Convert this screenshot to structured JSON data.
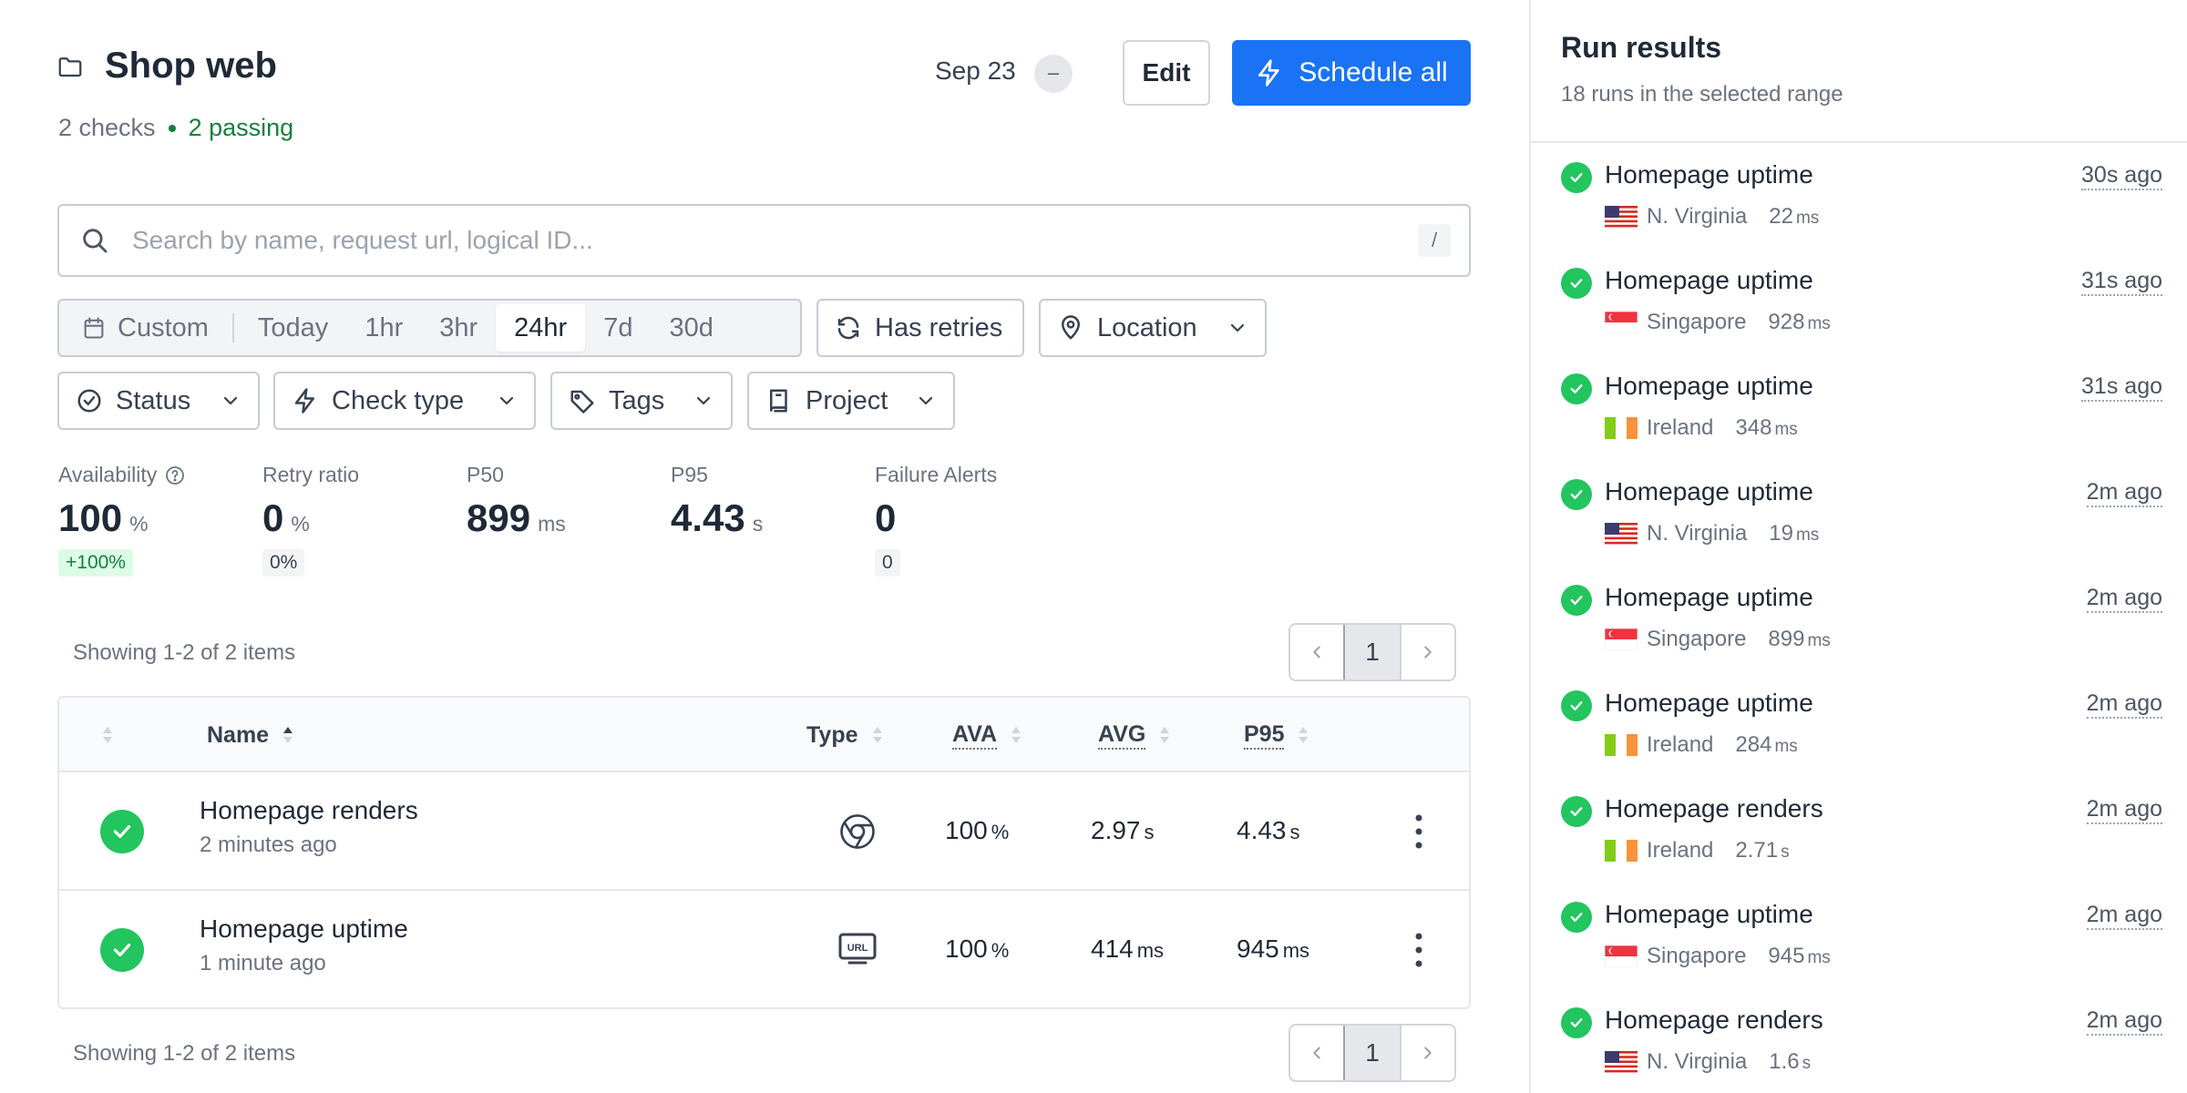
{
  "header": {
    "title": "Shop web",
    "checks_count": "2 checks",
    "passing": "2 passing",
    "date": "Sep 23",
    "date_clear": "–",
    "edit_label": "Edit",
    "schedule_label": "Schedule all"
  },
  "search": {
    "placeholder": "Search by name, request url, logical ID...",
    "shortcut": "/"
  },
  "time_ranges": {
    "custom": "Custom",
    "options": [
      "Today",
      "1hr",
      "3hr",
      "24hr",
      "7d",
      "30d"
    ],
    "selected": "24hr"
  },
  "filters": {
    "retries": "Has retries",
    "location": "Location",
    "status": "Status",
    "check_type": "Check type",
    "tags": "Tags",
    "project": "Project"
  },
  "stats": {
    "availability": {
      "label": "Availability",
      "value": "100",
      "unit": "%",
      "delta": "+100%"
    },
    "retry_ratio": {
      "label": "Retry ratio",
      "value": "0",
      "unit": "%",
      "delta": "0%"
    },
    "p50": {
      "label": "P50",
      "value": "899",
      "unit": "ms"
    },
    "p95": {
      "label": "P95",
      "value": "4.43",
      "unit": "s"
    },
    "failure_alerts": {
      "label": "Failure Alerts",
      "value": "0",
      "delta": "0"
    }
  },
  "pagination": {
    "showing": "Showing 1-2 of 2 items",
    "page": "1"
  },
  "table": {
    "columns": {
      "name": "Name",
      "type": "Type",
      "ava": "AVA",
      "avg": "AVG",
      "p95": "P95"
    },
    "rows": [
      {
        "name": "Homepage renders",
        "time": "2 minutes ago",
        "type_icon": "chrome-icon",
        "ava": "100",
        "ava_unit": "%",
        "avg": "2.97",
        "avg_unit": "s",
        "p95": "4.43",
        "p95_unit": "s"
      },
      {
        "name": "Homepage uptime",
        "time": "1 minute ago",
        "type_icon": "url-icon",
        "ava": "100",
        "ava_unit": "%",
        "avg": "414",
        "avg_unit": "ms",
        "p95": "945",
        "p95_unit": "ms"
      }
    ]
  },
  "panel": {
    "title": "Run results",
    "subtitle": "18 runs in the selected range",
    "runs": [
      {
        "name": "Homepage uptime",
        "ago": "30s ago",
        "location": "N. Virginia",
        "flag": "us",
        "duration": "22",
        "unit": "ms"
      },
      {
        "name": "Homepage uptime",
        "ago": "31s ago",
        "location": "Singapore",
        "flag": "sg",
        "duration": "928",
        "unit": "ms"
      },
      {
        "name": "Homepage uptime",
        "ago": "31s ago",
        "location": "Ireland",
        "flag": "ie",
        "duration": "348",
        "unit": "ms"
      },
      {
        "name": "Homepage uptime",
        "ago": "2m ago",
        "location": "N. Virginia",
        "flag": "us",
        "duration": "19",
        "unit": "ms"
      },
      {
        "name": "Homepage uptime",
        "ago": "2m ago",
        "location": "Singapore",
        "flag": "sg",
        "duration": "899",
        "unit": "ms"
      },
      {
        "name": "Homepage uptime",
        "ago": "2m ago",
        "location": "Ireland",
        "flag": "ie",
        "duration": "284",
        "unit": "ms"
      },
      {
        "name": "Homepage renders",
        "ago": "2m ago",
        "location": "Ireland",
        "flag": "ie",
        "duration": "2.71",
        "unit": "s"
      },
      {
        "name": "Homepage uptime",
        "ago": "2m ago",
        "location": "Singapore",
        "flag": "sg",
        "duration": "945",
        "unit": "ms"
      },
      {
        "name": "Homepage renders",
        "ago": "2m ago",
        "location": "N. Virginia",
        "flag": "us",
        "duration": "1.6",
        "unit": "s"
      }
    ]
  },
  "colors": {
    "primary": "#1a73f5",
    "success": "#22c55e",
    "passing_text": "#15803d"
  }
}
